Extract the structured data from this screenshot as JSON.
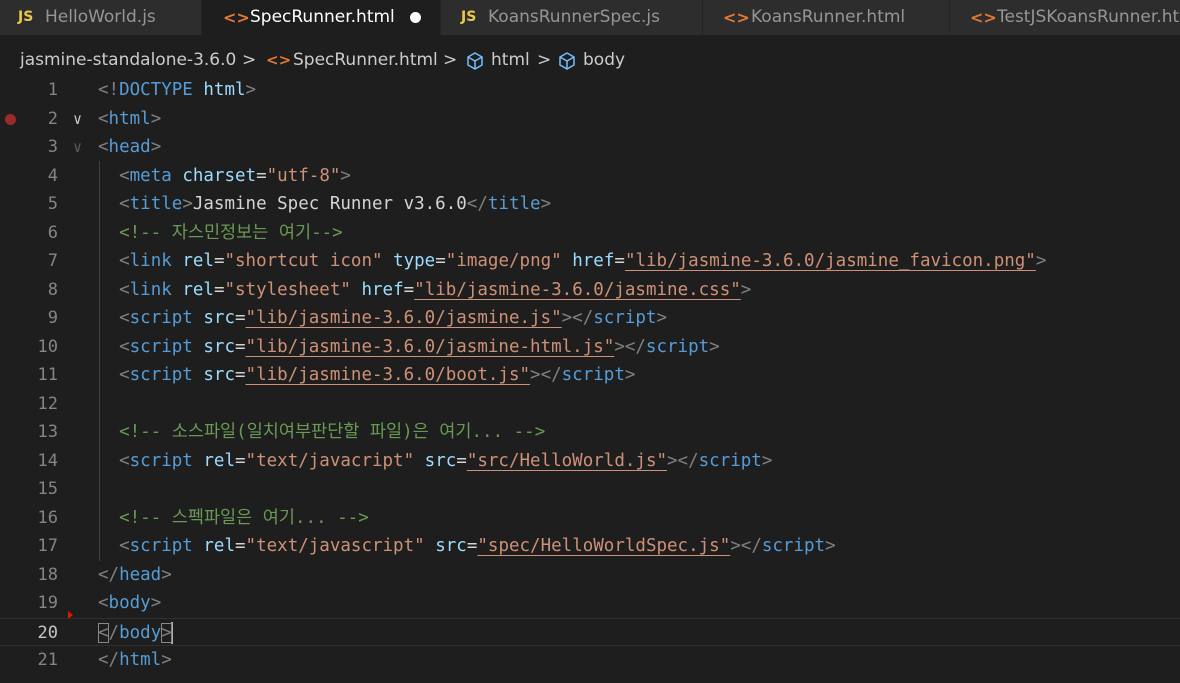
{
  "tabs": [
    {
      "label": "HelloWorld.js",
      "icon": "JS",
      "type": "js",
      "active": false
    },
    {
      "label": "SpecRunner.html",
      "icon": "<>",
      "type": "html",
      "active": true,
      "dirty": true
    },
    {
      "label": "KoansRunnerSpec.js",
      "icon": "JS",
      "type": "js",
      "active": false
    },
    {
      "label": "KoansRunner.html",
      "icon": "<>",
      "type": "html",
      "active": false
    },
    {
      "label": "TestJSKoansRunner.ht",
      "icon": "<>",
      "type": "html",
      "active": false
    }
  ],
  "breadcrumb": {
    "folder": "jasmine-standalone-3.6.0",
    "file": "SpecRunner.html",
    "html_icon": "<>",
    "node1": "html",
    "node2": "body",
    "sep": ">"
  },
  "editor": {
    "current_line": 20,
    "lines": [
      {
        "n": "1",
        "tokens": [
          [
            "p",
            "<!"
          ],
          [
            "tag",
            "DOCTYPE"
          ],
          [
            "txt",
            " "
          ],
          [
            "attr",
            "html"
          ],
          [
            "p",
            ">"
          ]
        ]
      },
      {
        "n": "2",
        "fold": "open",
        "breakpoint": true,
        "tokens": [
          [
            "p",
            "<"
          ],
          [
            "tag",
            "html"
          ],
          [
            "p",
            ">"
          ]
        ]
      },
      {
        "n": "3",
        "fold": "open-dim",
        "tokens": [
          [
            "p",
            "<"
          ],
          [
            "tag",
            "head"
          ],
          [
            "p",
            ">"
          ]
        ]
      },
      {
        "n": "4",
        "indent": "  ",
        "tokens": [
          [
            "p",
            "<"
          ],
          [
            "tag",
            "meta"
          ],
          [
            "txt",
            " "
          ],
          [
            "attr",
            "charset"
          ],
          [
            "txt",
            "="
          ],
          [
            "str",
            "\"utf-8\""
          ],
          [
            "p",
            ">"
          ]
        ]
      },
      {
        "n": "5",
        "indent": "  ",
        "tokens": [
          [
            "p",
            "<"
          ],
          [
            "tag",
            "title"
          ],
          [
            "p",
            ">"
          ],
          [
            "txt",
            "Jasmine Spec Runner v3.6.0"
          ],
          [
            "p",
            "</"
          ],
          [
            "tag",
            "title"
          ],
          [
            "p",
            ">"
          ]
        ]
      },
      {
        "n": "6",
        "indent": "  ",
        "tokens": [
          [
            "cm",
            "<!-- 자스민정보는 여기-->"
          ]
        ]
      },
      {
        "n": "7",
        "indent": "  ",
        "tokens": [
          [
            "p",
            "<"
          ],
          [
            "tag",
            "link"
          ],
          [
            "txt",
            " "
          ],
          [
            "attr",
            "rel"
          ],
          [
            "txt",
            "="
          ],
          [
            "str",
            "\"shortcut icon\""
          ],
          [
            "txt",
            " "
          ],
          [
            "attr",
            "type"
          ],
          [
            "txt",
            "="
          ],
          [
            "str",
            "\"image/png\""
          ],
          [
            "txt",
            " "
          ],
          [
            "attr",
            "href"
          ],
          [
            "txt",
            "="
          ],
          [
            "link",
            "\"lib/jasmine-3.6.0/jasmine_favicon.png\""
          ],
          [
            "p",
            ">"
          ]
        ]
      },
      {
        "n": "8",
        "indent": "  ",
        "tokens": [
          [
            "p",
            "<"
          ],
          [
            "tag",
            "link"
          ],
          [
            "txt",
            " "
          ],
          [
            "attr",
            "rel"
          ],
          [
            "txt",
            "="
          ],
          [
            "str",
            "\"stylesheet\""
          ],
          [
            "txt",
            " "
          ],
          [
            "attr",
            "href"
          ],
          [
            "txt",
            "="
          ],
          [
            "link",
            "\"lib/jasmine-3.6.0/jasmine.css\""
          ],
          [
            "p",
            ">"
          ]
        ]
      },
      {
        "n": "9",
        "indent": "  ",
        "tokens": [
          [
            "p",
            "<"
          ],
          [
            "tag",
            "script"
          ],
          [
            "txt",
            " "
          ],
          [
            "attr",
            "src"
          ],
          [
            "txt",
            "="
          ],
          [
            "link",
            "\"lib/jasmine-3.6.0/jasmine.js\""
          ],
          [
            "p",
            "></"
          ],
          [
            "tag",
            "script"
          ],
          [
            "p",
            ">"
          ]
        ]
      },
      {
        "n": "10",
        "indent": "  ",
        "tokens": [
          [
            "p",
            "<"
          ],
          [
            "tag",
            "script"
          ],
          [
            "txt",
            " "
          ],
          [
            "attr",
            "src"
          ],
          [
            "txt",
            "="
          ],
          [
            "link",
            "\"lib/jasmine-3.6.0/jasmine-html.js\""
          ],
          [
            "p",
            "></"
          ],
          [
            "tag",
            "script"
          ],
          [
            "p",
            ">"
          ]
        ]
      },
      {
        "n": "11",
        "indent": "  ",
        "tokens": [
          [
            "p",
            "<"
          ],
          [
            "tag",
            "script"
          ],
          [
            "txt",
            " "
          ],
          [
            "attr",
            "src"
          ],
          [
            "txt",
            "="
          ],
          [
            "link",
            "\"lib/jasmine-3.6.0/boot.js\""
          ],
          [
            "p",
            "></"
          ],
          [
            "tag",
            "script"
          ],
          [
            "p",
            ">"
          ]
        ]
      },
      {
        "n": "12",
        "indent": "",
        "tokens": []
      },
      {
        "n": "13",
        "indent": "  ",
        "tokens": [
          [
            "cm",
            "<!-- 소스파일(일치여부판단할 파일)은 여기... -->"
          ]
        ]
      },
      {
        "n": "14",
        "indent": "  ",
        "tokens": [
          [
            "p",
            "<"
          ],
          [
            "tag",
            "script"
          ],
          [
            "txt",
            " "
          ],
          [
            "attr",
            "rel"
          ],
          [
            "txt",
            "="
          ],
          [
            "str",
            "\"text/javacript\""
          ],
          [
            "txt",
            " "
          ],
          [
            "attr",
            "src"
          ],
          [
            "txt",
            "="
          ],
          [
            "link",
            "\"src/HelloWorld.js\""
          ],
          [
            "p",
            "></"
          ],
          [
            "tag",
            "script"
          ],
          [
            "p",
            ">"
          ]
        ]
      },
      {
        "n": "15",
        "indent": "",
        "tokens": []
      },
      {
        "n": "16",
        "indent": "  ",
        "tokens": [
          [
            "cm",
            "<!-- 스펙파일은 여기... -->"
          ]
        ]
      },
      {
        "n": "17",
        "indent": "  ",
        "tokens": [
          [
            "p",
            "<"
          ],
          [
            "tag",
            "script"
          ],
          [
            "txt",
            " "
          ],
          [
            "attr",
            "rel"
          ],
          [
            "txt",
            "="
          ],
          [
            "str",
            "\"text/javascript\""
          ],
          [
            "txt",
            " "
          ],
          [
            "attr",
            "src"
          ],
          [
            "txt",
            "="
          ],
          [
            "link",
            "\"spec/HelloWorldSpec.js\""
          ],
          [
            "p",
            "></"
          ],
          [
            "tag",
            "script"
          ],
          [
            "p",
            ">"
          ]
        ]
      },
      {
        "n": "18",
        "tokens": [
          [
            "p",
            "</"
          ],
          [
            "tag",
            "head"
          ],
          [
            "p",
            ">"
          ]
        ]
      },
      {
        "n": "19",
        "error_marker": true,
        "tokens": [
          [
            "p",
            "<"
          ],
          [
            "tag",
            "body"
          ],
          [
            "p",
            ">"
          ]
        ]
      },
      {
        "n": "20",
        "cursor": true,
        "tokens": [
          [
            "pb",
            "<"
          ],
          [
            "p",
            "/"
          ],
          [
            "tag",
            "body"
          ],
          [
            "pb",
            ">"
          ]
        ]
      },
      {
        "n": "21",
        "tokens": [
          [
            "p",
            "</"
          ],
          [
            "tag",
            "html"
          ],
          [
            "p",
            ">"
          ]
        ]
      }
    ]
  },
  "colors": {
    "background": "#1e1e1e",
    "tag": "#569cd6",
    "attr": "#9cdcfe",
    "string": "#ce9178",
    "comment": "#6a9955",
    "js_icon": "#e8c94b",
    "html_icon": "#e37933"
  }
}
